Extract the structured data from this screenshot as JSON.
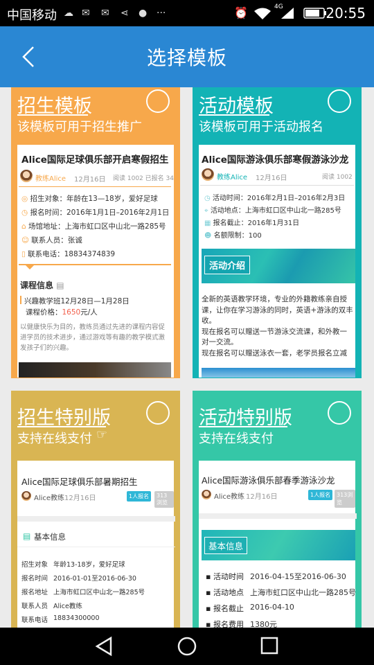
{
  "status": {
    "carrier": "中国移动",
    "time": "20:55",
    "net": "4G"
  },
  "header": {
    "title": "选择模板"
  },
  "colors": {
    "appbar": "#2a87d3",
    "orange": "#f7a84b",
    "teal": "#13b3b5",
    "mustard": "#d9b553",
    "green": "#35c7a7"
  },
  "cards": [
    {
      "title": "招生模板",
      "subtitle": "该模板可用于招生推广",
      "preview": {
        "name": "Alice国际足球俱乐部开启寒假招生",
        "coach": "教练Alice",
        "date": "12月16日",
        "stats": "阅读 1002  已报名 34",
        "rows": [
          "招生对象：年龄在13—18岁，爱好足球",
          "报名时间：2016年1月1日–2016年2月1日",
          "场馆地址：上海市虹口区中山北一路285号",
          "联系人员：张诚",
          "联系电话：18834374839"
        ],
        "course_title": "课程信息",
        "course_line": "兴趣教学班12月28日—1月28日",
        "price_label": "课程价格：",
        "price": "1650",
        "price_unit": "元/人",
        "desc": "以健康快乐为目的，教练员通过先进的课程内容促进学员的技术进步，通过游戏等有趣的教学模式激发孩子们的兴趣。"
      }
    },
    {
      "title": "活动模板",
      "subtitle": "该模板可用于活动报名",
      "preview": {
        "name": "Alice国际游泳俱乐部寒假游泳沙龙",
        "coach": "教练Alice",
        "date": "12月16日",
        "stats": "阅读 1002",
        "rows": [
          "活动时间：2016年2月1日–2016年2月3日",
          "活动地点：上海市虹口区中山北一路285号",
          "报名截止：2016年1月31日",
          "名额限制：100"
        ],
        "banner": "活动介绍",
        "desc": [
          "全新的英语教学环境，专业的外籍教练亲自授课，让你在学习游泳的同时，英语+游泳的双丰收。",
          "现在报名可以赠送一节游泳交流课，和外教一对一交流。",
          "现在报名可以赠送泳衣一套，老学员报名立减"
        ]
      }
    },
    {
      "title": "招生特别版",
      "subtitle": "支持在线支付",
      "preview": {
        "name": "Alice国际足球俱乐部暑期招生",
        "coach": "Alice教练",
        "date": "12月16日",
        "badge1": "1人报名",
        "badge2": "313浏览",
        "section": "基本信息",
        "fields": [
          [
            "招生对象",
            "年龄13-18岁，爱好足球"
          ],
          [
            "报名时间",
            "2016-01-01至2016-06-30"
          ],
          [
            "报名地址",
            "上海市虹口区中山北一路285号"
          ],
          [
            "联系人员",
            "Alice教练"
          ],
          [
            "联系电话",
            "18834300000"
          ]
        ]
      }
    },
    {
      "title": "活动特别版",
      "subtitle": "支持在线支付",
      "preview": {
        "name": "Alice国际游泳俱乐部春季游泳沙龙",
        "coach": "Alice教练",
        "date": "12月16日",
        "badge1": "1人报名",
        "badge2": "313浏览",
        "section": "基本信息",
        "fields": [
          [
            "活动时间",
            "2016-04-15至2016-06-30"
          ],
          [
            "活动地点",
            "上海市虹口区中山北一路285号"
          ],
          [
            "报名截止",
            "2016-04-10"
          ],
          [
            "报名费用",
            "1380元"
          ]
        ]
      }
    }
  ]
}
